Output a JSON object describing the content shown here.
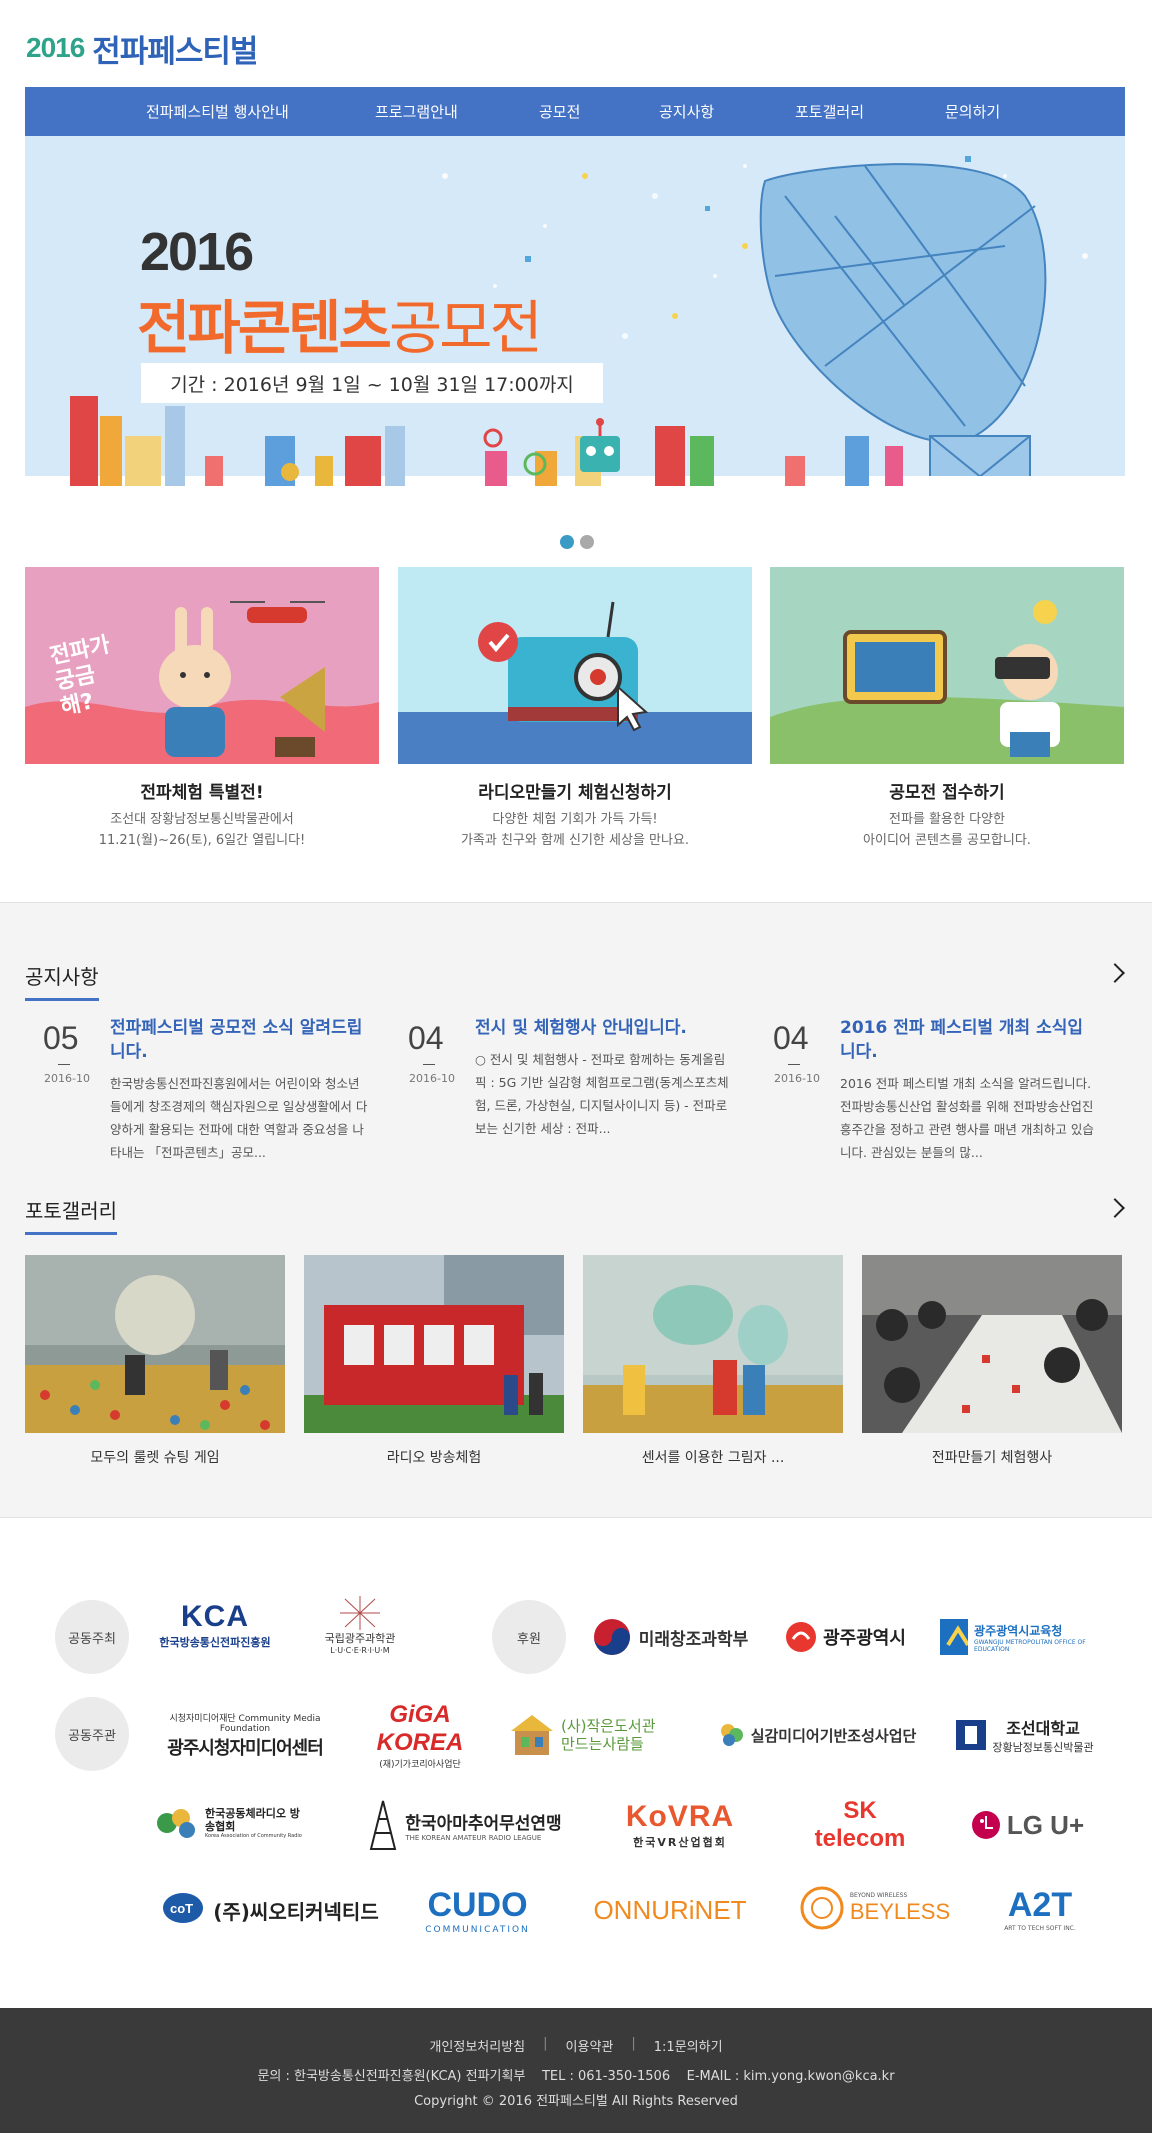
{
  "header": {
    "logo_year": "2016",
    "logo_text": "전파페스티벌"
  },
  "nav": [
    "전파페스티벌 행사안내",
    "프로그램안내",
    "공모전",
    "공지사항",
    "포토갤러리",
    "문의하기"
  ],
  "banner": {
    "year": "2016",
    "title_part1": "전파콘텐츠",
    "title_part2": "공모전",
    "period": "기간 : 2016년 9월 1일 ~ 10월 31일 17:00까지",
    "active_slide": 1,
    "slide_count": 2
  },
  "cards": [
    {
      "title": "전파체험 특별전!",
      "line1": "조선대 장황남정보통신박물관에서",
      "line2": "11.21(월)~26(토), 6일간 열립니다!",
      "image_text": "전파가 궁금해?"
    },
    {
      "title": "라디오만들기 체험신청하기",
      "line1": "다양한 체험 기회가 가득 가득!",
      "line2": "가족과 친구와 함께 신기한 세상을 만나요."
    },
    {
      "title": "공모전 접수하기",
      "line1": "전파를 활용한 다양한",
      "line2": "아이디어 콘텐츠를 공모합니다."
    }
  ],
  "notice": {
    "title": "공지사항",
    "items": [
      {
        "day": "05",
        "ym": "2016-10",
        "title": "전파페스티벌 공모전 소식 알려드립니다.",
        "body": "한국방송통신전파진흥원에서는 어린이와 청소년들에게 창조경제의 핵심자원으로 일상생활에서 다양하게 활용되는 전파에 대한 역할과 중요성을 나타내는 「전파콘텐츠」공모..."
      },
      {
        "day": "04",
        "ym": "2016-10",
        "title": "전시 및 체험행사 안내입니다.",
        "body": "○ 전시 및 체험행사 - 전파로 함께하는 동계올림픽 : 5G 기반 실감형 체험프로그램(동계스포츠체험, 드론, 가상현실, 디지털사이니지 등) - 전파로 보는 신기한 세상 : 전파..."
      },
      {
        "day": "04",
        "ym": "2016-10",
        "title": "2016 전파 페스티벌 개최 소식입니다.",
        "body": "2016 전파 페스티벌 개최 소식을 알려드립니다. 전파방송통신산업 활성화를 위해 전파방송산업진흥주간을 정하고 관련 행사를 매년 개최하고 있습니다. 관심있는 분들의 많..."
      }
    ]
  },
  "gallery": {
    "title": "포토갤러리",
    "items": [
      {
        "caption": "모두의 룰렛 슈팅 게임"
      },
      {
        "caption": "라디오 방송체험"
      },
      {
        "caption": "센서를 이용한 그림자 ..."
      },
      {
        "caption": "전파만들기 체험행사"
      }
    ]
  },
  "sponsors": {
    "host_label": "공동주최",
    "support_label": "후원",
    "organizer_label": "공동주관",
    "hosts": [
      {
        "name": "KCA",
        "sub": "한국방송통신전파진흥원"
      },
      {
        "name": "국립광주과학관",
        "sub": "L·U·C·E·R·I·U·M"
      }
    ],
    "supporters": [
      {
        "name": "미래창조과학부"
      },
      {
        "name": "광주광역시"
      },
      {
        "name": "광주광역시교육청",
        "sub": "GWANGJU METROPOLITAN OFFICE OF EDUCATION"
      }
    ],
    "organizers_row1": [
      {
        "name": "광주시청자미디어센터",
        "sub": "시청자미디어재단 Community Media Foundation"
      },
      {
        "name": "GiGA KOREA",
        "sub": "(재)기가코리아사업단"
      },
      {
        "name": "(사)작은도서관 만드는사람들"
      },
      {
        "name": "실감미디어기반조성사업단"
      },
      {
        "name": "조선대학교",
        "sub": "장황남정보통신박물관"
      }
    ],
    "organizers_row2": [
      {
        "name": "한국공동체라디오 방송협회",
        "sub": "Korea Association of Community Radio"
      },
      {
        "name": "한국아마추어무선연맹",
        "sub": "THE KOREAN AMATEUR RADIO LEAGUE"
      },
      {
        "name": "KoVRA",
        "sub": "한국VR산업협회"
      },
      {
        "name": "SK telecom"
      },
      {
        "name": "LG U+"
      }
    ],
    "organizers_row3": [
      {
        "name": "(주)씨오티커넥티드"
      },
      {
        "name": "CUDO",
        "sub": "COMMUNICATION"
      },
      {
        "name": "ONNURiNET"
      },
      {
        "name": "BEYLESS",
        "sub": "BEYOND WIRELESS"
      },
      {
        "name": "A2T",
        "sub": "ART TO TECH SOFT INC."
      }
    ]
  },
  "footer": {
    "links": [
      "개인정보처리방침",
      "이용약관",
      "1:1문의하기"
    ],
    "contact": "문의 : 한국방송통신전파진흥원(KCA) 전파기획부    TEL : 061-350-1506    E-MAIL : kim.yong.kwon@kca.kr",
    "copyright": "Copyright © 2016 전파페스티벌 All Rights Reserved"
  },
  "colors": {
    "brand_blue": "#4472c4",
    "logo_green": "#2fa38a",
    "accent_orange": "#f26a2b",
    "notice_title_blue": "#3464b8",
    "footer_bg": "#3a3a3a"
  }
}
